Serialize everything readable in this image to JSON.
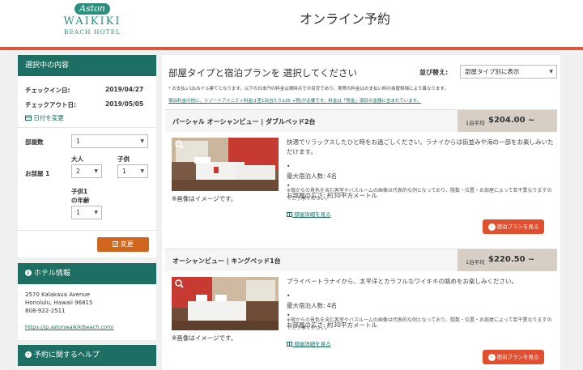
{
  "brand": {
    "logo_script": "Aston",
    "logo_main": "WAIKIKI",
    "logo_sub": "BEACH HOTEL"
  },
  "header": {
    "title": "オンライン予約"
  },
  "colors": {
    "accent_red": "#d9593f",
    "brand_green": "#1c6f62",
    "button_orange": "#d0651d",
    "plan_button": "#e14f2f"
  },
  "sidebar": {
    "selection": {
      "heading": "選択中の内容",
      "checkin_label": "チェックイン日:",
      "checkin_value": "2019/04/27",
      "checkout_label": "チェックアウト日:",
      "checkout_value": "2019/05/05",
      "change_dates": "日付を変更",
      "rooms_label": "部屋数",
      "rooms_value": "1",
      "room1_label": "お部屋 1",
      "adults_label": "大人",
      "adults_value": "2",
      "children_label": "子供",
      "children_value": "1",
      "child_age_label_1": "子供1",
      "child_age_label_2": "の年齢",
      "child_age_value": "1",
      "change_button": "変更"
    },
    "hotel_info": {
      "heading": "ホテル情報",
      "address1": "2570 Kalakaua Avenue",
      "address2": "Honolulu, Hawaii 96815",
      "phone": "808-922-2511",
      "url": "https://jp.astonwaikikibeach.com/"
    },
    "help": {
      "heading": "予約に関するヘルプ"
    }
  },
  "main": {
    "heading": "部屋タイプと宿泊プランを 選択してください",
    "sort_label": "並び替え:",
    "sort_value": "部屋タイプ別に表示",
    "note1": "* お支払いはUSドル建てとなります。以下の日本円の料金は現時点での目安であり、実際の料金はお支払い時の為替相場により異なります。",
    "note2": "宿泊料金の他に、リゾートアメニティ料金(1室1泊当たり$35 +税)が必要です。料金は「税金」項目の金額に含まれています。",
    "rooms": [
      {
        "name": "パーシャル オーシャンビュー | ダブルベッド2台",
        "price_label": "1泊平均",
        "price": "$204.00 ~",
        "caption": "※画像はイメージです。",
        "desc": "快適でリラックスしたひと時をお過ごしください。ラナイからは街並みや海の一部をお楽しみいただけます。",
        "guests": "最大宿泊人数: 4名",
        "size": "お部屋の広さ: 約30平方メートル",
        "note": "※宿からの景色を含む客室やバスルームの画像は代表的な例となっており、階数・位置・お部屋によって若干異なりますのでご了承ください。",
        "floor_link": "部屋詳細を見る",
        "plan_button": "宿泊プランを見る"
      },
      {
        "name": "オーシャンビュー | キングベッド1台",
        "price_label": "1泊平均",
        "price": "$220.50 ~",
        "caption": "※画像はイメージです。",
        "desc": "プライベートラナイから、太平洋とカラフルなワイキキの眺めをお楽しみください。",
        "guests": "最大宿泊人数: 4名",
        "size": "お部屋の広さ: 約30平方メートル",
        "note": "※宿からの景色を含む客室やバスルームの画像は代表的な例となっており、階数・位置・お部屋によって若干異なりますのでご了承ください。",
        "floor_link": "部屋詳細を見る",
        "plan_button": "宿泊プランを見る"
      }
    ]
  }
}
